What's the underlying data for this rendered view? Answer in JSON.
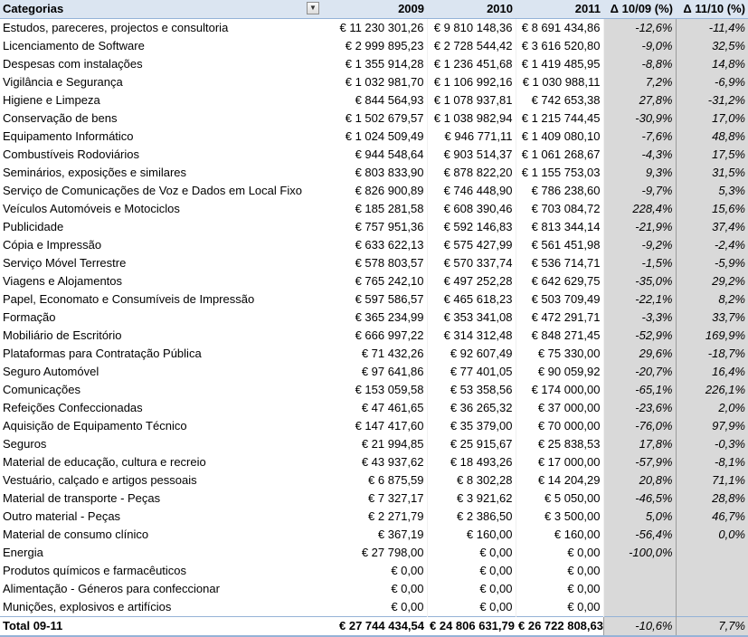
{
  "header": {
    "category": "Categorias",
    "y2009": "2009",
    "y2010": "2010",
    "y2011": "2011",
    "delta1": "Δ 10/09 (%)",
    "delta2": "Δ 11/10 (%)",
    "filter_icon": "dropdown-filter-icon"
  },
  "rows": [
    [
      "Estudos, pareceres, projectos e consultoria",
      "€ 11 230 301,26",
      "€ 9 810 148,36",
      "€ 8 691 434,86",
      "-12,6%",
      "-11,4%"
    ],
    [
      "Licenciamento de Software",
      "€ 2 999 895,23",
      "€ 2 728 544,42",
      "€ 3 616 520,80",
      "-9,0%",
      "32,5%"
    ],
    [
      "Despesas com instalações",
      "€ 1 355 914,28",
      "€ 1 236 451,68",
      "€ 1 419 485,95",
      "-8,8%",
      "14,8%"
    ],
    [
      "Vigilância e Segurança",
      "€ 1 032 981,70",
      "€ 1 106 992,16",
      "€ 1 030 988,11",
      "7,2%",
      "-6,9%"
    ],
    [
      "Higiene e Limpeza",
      "€ 844 564,93",
      "€ 1 078 937,81",
      "€ 742 653,38",
      "27,8%",
      "-31,2%"
    ],
    [
      "Conservação de bens",
      "€ 1 502 679,57",
      "€ 1 038 982,94",
      "€ 1 215 744,45",
      "-30,9%",
      "17,0%"
    ],
    [
      "Equipamento Informático",
      "€ 1 024 509,49",
      "€ 946 771,11",
      "€ 1 409 080,10",
      "-7,6%",
      "48,8%"
    ],
    [
      "Combustíveis Rodoviários",
      "€ 944 548,64",
      "€ 903 514,37",
      "€ 1 061 268,67",
      "-4,3%",
      "17,5%"
    ],
    [
      "Seminários, exposições e similares",
      "€ 803 833,90",
      "€ 878 822,20",
      "€ 1 155 753,03",
      "9,3%",
      "31,5%"
    ],
    [
      "Serviço de Comunicações de Voz e Dados em Local Fixo",
      "€ 826 900,89",
      "€ 746 448,90",
      "€ 786 238,60",
      "-9,7%",
      "5,3%"
    ],
    [
      "Veículos Automóveis e Motociclos",
      "€ 185 281,58",
      "€ 608 390,46",
      "€ 703 084,72",
      "228,4%",
      "15,6%"
    ],
    [
      "Publicidade",
      "€ 757 951,36",
      "€ 592 146,83",
      "€ 813 344,14",
      "-21,9%",
      "37,4%"
    ],
    [
      "Cópia e Impressão",
      "€ 633 622,13",
      "€ 575 427,99",
      "€ 561 451,98",
      "-9,2%",
      "-2,4%"
    ],
    [
      "Serviço Móvel Terrestre",
      "€ 578 803,57",
      "€ 570 337,74",
      "€ 536 714,71",
      "-1,5%",
      "-5,9%"
    ],
    [
      "Viagens e Alojamentos",
      "€ 765 242,10",
      "€ 497 252,28",
      "€ 642 629,75",
      "-35,0%",
      "29,2%"
    ],
    [
      "Papel, Economato e Consumíveis de Impressão",
      "€ 597 586,57",
      "€ 465 618,23",
      "€ 503 709,49",
      "-22,1%",
      "8,2%"
    ],
    [
      "Formação",
      "€ 365 234,99",
      "€ 353 341,08",
      "€ 472 291,71",
      "-3,3%",
      "33,7%"
    ],
    [
      "Mobiliário de Escritório",
      "€ 666 997,22",
      "€ 314 312,48",
      "€ 848 271,45",
      "-52,9%",
      "169,9%"
    ],
    [
      "Plataformas para Contratação Pública",
      "€ 71 432,26",
      "€ 92 607,49",
      "€ 75 330,00",
      "29,6%",
      "-18,7%"
    ],
    [
      "Seguro Automóvel",
      "€ 97 641,86",
      "€ 77 401,05",
      "€ 90 059,92",
      "-20,7%",
      "16,4%"
    ],
    [
      "Comunicações",
      "€ 153 059,58",
      "€ 53 358,56",
      "€ 174 000,00",
      "-65,1%",
      "226,1%"
    ],
    [
      "Refeições Confeccionadas",
      "€ 47 461,65",
      "€ 36 265,32",
      "€ 37 000,00",
      "-23,6%",
      "2,0%"
    ],
    [
      "Aquisição de Equipamento Técnico",
      "€ 147 417,60",
      "€ 35 379,00",
      "€ 70 000,00",
      "-76,0%",
      "97,9%"
    ],
    [
      "Seguros",
      "€ 21 994,85",
      "€ 25 915,67",
      "€ 25 838,53",
      "17,8%",
      "-0,3%"
    ],
    [
      "Material de educação, cultura e recreio",
      "€ 43 937,62",
      "€ 18 493,26",
      "€ 17 000,00",
      "-57,9%",
      "-8,1%"
    ],
    [
      "Vestuário, calçado e artigos pessoais",
      "€ 6 875,59",
      "€ 8 302,28",
      "€ 14 204,29",
      "20,8%",
      "71,1%"
    ],
    [
      "Material de transporte - Peças",
      "€ 7 327,17",
      "€ 3 921,62",
      "€ 5 050,00",
      "-46,5%",
      "28,8%"
    ],
    [
      "Outro material - Peças",
      "€ 2 271,79",
      "€ 2 386,50",
      "€ 3 500,00",
      "5,0%",
      "46,7%"
    ],
    [
      "Material de consumo clínico",
      "€ 367,19",
      "€ 160,00",
      "€ 160,00",
      "-56,4%",
      "0,0%"
    ],
    [
      "Energia",
      "€ 27 798,00",
      "€ 0,00",
      "€ 0,00",
      "-100,0%",
      ""
    ],
    [
      "Produtos químicos e farmacêuticos",
      "€ 0,00",
      "€ 0,00",
      "€ 0,00",
      "",
      ""
    ],
    [
      "Alimentação - Géneros para confeccionar",
      "€ 0,00",
      "€ 0,00",
      "€ 0,00",
      "",
      ""
    ],
    [
      "Munições, explosivos e artifícios",
      "€ 0,00",
      "€ 0,00",
      "€ 0,00",
      "",
      ""
    ]
  ],
  "total": {
    "label": "Total 09-11",
    "y2009": "€ 27 744 434,54",
    "y2010": "€ 24 806 631,79",
    "y2011": "€ 26 722 808,63",
    "delta1": "-10,6%",
    "delta2": "7,7%"
  }
}
